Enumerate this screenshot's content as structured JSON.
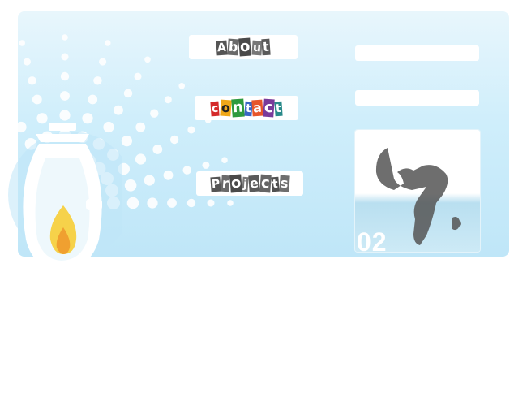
{
  "nav": [
    {
      "label": "About",
      "colors": [
        "#555555",
        "#6a6a6a",
        "#4a4a4a",
        "#777777",
        "#5a5a5a"
      ],
      "text": [
        "#ffffff",
        "#ffffff",
        "#ffffff",
        "#ffffff",
        "#ffffff"
      ]
    },
    {
      "label": "contact",
      "colors": [
        "#d42a2a",
        "#f0a818",
        "#2e9a3e",
        "#3a66c4",
        "#e7552a",
        "#7a3b9a",
        "#2a8a8a"
      ],
      "text": [
        "#ffffff",
        "#222222",
        "#ffffff",
        "#ffffff",
        "#ffffff",
        "#ffffff",
        "#ffffff"
      ]
    },
    {
      "label": "Projects",
      "colors": [
        "#555555",
        "#6a6a6a",
        "#4a4a4a",
        "#777777",
        "#5a5a5a",
        "#666666",
        "#505050",
        "#6e6e6e"
      ],
      "text": [
        "#ffffff",
        "#ffffff",
        "#ffffff",
        "#ffffff",
        "#ffffff",
        "#ffffff",
        "#ffffff",
        "#ffffff"
      ]
    }
  ],
  "year_fragment": "02",
  "colors": {
    "panel": "#cfeefb",
    "lamp_glass": "#eef8fc",
    "flame": "#f6d24a",
    "flame_core": "#f0a030"
  },
  "icons": {
    "lamp": "oil-lamp-icon",
    "map": "africa-map-icon"
  }
}
